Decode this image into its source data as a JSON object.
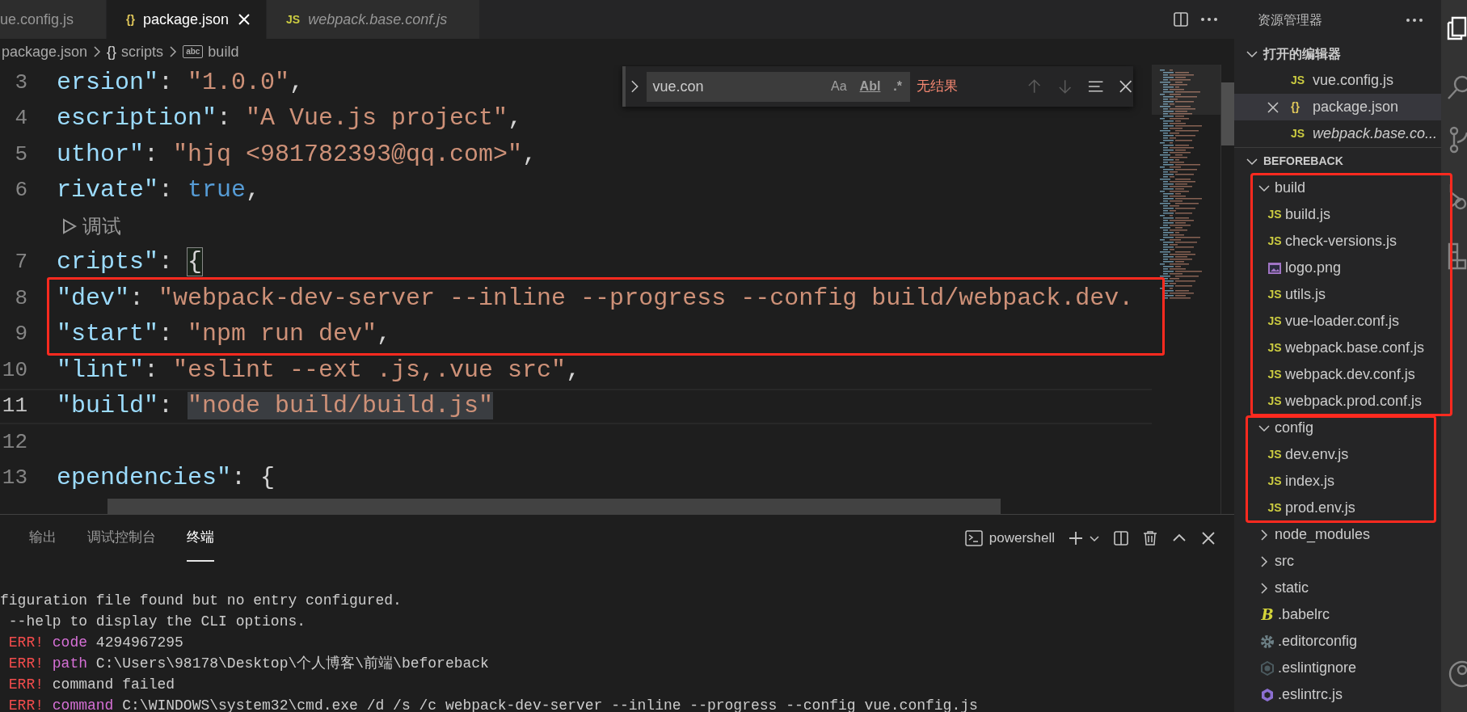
{
  "tabs": [
    {
      "label": "ue.config.js",
      "selected": false,
      "preview": false
    },
    {
      "label": "package.json",
      "kind": "json",
      "icon": "{}",
      "selected": true,
      "preview": false
    },
    {
      "label": "webpack.base.conf.js",
      "kind": "js",
      "icon": "JS",
      "selected": false,
      "preview": true
    }
  ],
  "breadcrumb": [
    {
      "text": "package.json"
    },
    {
      "kind": "object",
      "icon": "{}",
      "text": "scripts"
    },
    {
      "kind": "string",
      "icon": "abc",
      "text": "build"
    }
  ],
  "code": [
    {
      "kind": "code",
      "number": "3",
      "tokens": [
        {
          "kind": "key",
          "text": "ersion\""
        },
        {
          "kind": "punct",
          "text": ": "
        },
        {
          "kind": "string",
          "text": "\"1.0.0\""
        },
        {
          "kind": "punct",
          "text": ","
        }
      ]
    },
    {
      "kind": "code",
      "number": "4",
      "tokens": [
        {
          "kind": "key",
          "text": "escription\""
        },
        {
          "kind": "punct",
          "text": ": "
        },
        {
          "kind": "string",
          "text": "\"A Vue.js project\""
        },
        {
          "kind": "punct",
          "text": ","
        }
      ]
    },
    {
      "kind": "code",
      "number": "5",
      "tokens": [
        {
          "kind": "key",
          "text": "uthor\""
        },
        {
          "kind": "punct",
          "text": ": "
        },
        {
          "kind": "string",
          "text": "\"hjq <981782393@qq.com>\""
        },
        {
          "kind": "punct",
          "text": ","
        }
      ]
    },
    {
      "kind": "code",
      "number": "6",
      "tokens": [
        {
          "kind": "key",
          "text": "rivate\""
        },
        {
          "kind": "punct",
          "text": ": "
        },
        {
          "kind": "bool",
          "text": "true"
        },
        {
          "kind": "punct",
          "text": ","
        }
      ]
    },
    {
      "kind": "codelens",
      "text": "调试"
    },
    {
      "kind": "code",
      "number": "7",
      "tokens": [
        {
          "kind": "key",
          "text": "cripts\""
        },
        {
          "kind": "punct",
          "text": ": "
        },
        {
          "kind": "punct",
          "text": "{",
          "matched": true
        }
      ]
    },
    {
      "kind": "code",
      "number": "8",
      "highlighted": true,
      "tokens": [
        {
          "kind": "key",
          "text": "\"dev\""
        },
        {
          "kind": "punct",
          "text": ": "
        },
        {
          "kind": "string",
          "text": "\"webpack-dev-server --inline --progress --config build/webpack.dev."
        }
      ]
    },
    {
      "kind": "code",
      "number": "9",
      "highlighted": true,
      "tokens": [
        {
          "kind": "key",
          "text": "\"start\""
        },
        {
          "kind": "punct",
          "text": ": "
        },
        {
          "kind": "string",
          "text": "\"npm run dev\""
        },
        {
          "kind": "punct",
          "text": ","
        }
      ]
    },
    {
      "kind": "code",
      "number": "10",
      "tokens": [
        {
          "kind": "key",
          "text": "\"lint\""
        },
        {
          "kind": "punct",
          "text": ": "
        },
        {
          "kind": "string",
          "text": "\"eslint --ext .js,.vue src\""
        },
        {
          "kind": "punct",
          "text": ","
        }
      ]
    },
    {
      "kind": "code",
      "number": "11",
      "current": true,
      "tokens": [
        {
          "kind": "key",
          "text": "\"build\""
        },
        {
          "kind": "punct",
          "text": ": "
        },
        {
          "kind": "string",
          "text": "\"node build/build.js\"",
          "selected": true
        }
      ]
    },
    {
      "kind": "code",
      "number": "12"
    },
    {
      "kind": "code",
      "number": "13",
      "tokens": [
        {
          "kind": "key",
          "text": "ependencies\""
        },
        {
          "kind": "punct",
          "text": ": "
        },
        {
          "kind": "punct",
          "text": "{"
        }
      ]
    }
  ],
  "find": {
    "query": "vue.con",
    "options": [
      {
        "text": "Aa",
        "on": false
      },
      {
        "text": "Abl",
        "on": false
      },
      {
        "text": ".*",
        "on": false
      }
    ],
    "status": "无结果"
  },
  "panel": {
    "tabs": [
      {
        "label": "输出",
        "selected": false
      },
      {
        "label": "调试控制台",
        "selected": false
      },
      {
        "label": "终端",
        "selected": true
      }
    ],
    "shell": "powershell",
    "lines": [
      [
        {
          "kind": "text",
          "text": "figuration file found but no entry configured."
        }
      ],
      [
        {
          "kind": "text",
          "text": " --help to display the CLI options."
        }
      ],
      [
        {
          "kind": "err",
          "text": " ERR! "
        },
        {
          "kind": "keyword",
          "text": "code"
        },
        {
          "kind": "text",
          "text": " 4294967295"
        }
      ],
      [
        {
          "kind": "err",
          "text": " ERR! "
        },
        {
          "kind": "keyword",
          "text": "path"
        },
        {
          "kind": "text",
          "text": " C:\\Users\\98178\\Desktop\\个人博客\\前端\\beforeback"
        }
      ],
      [
        {
          "kind": "err",
          "text": " ERR! "
        },
        {
          "kind": "text",
          "text": "command failed"
        }
      ],
      [
        {
          "kind": "err",
          "text": " ERR! "
        },
        {
          "kind": "keyword",
          "text": "command"
        },
        {
          "kind": "text",
          "text": " C:\\WINDOWS\\system32\\cmd.exe /d /s /c webpack-dev-server --inline --progress --config vue.config.js"
        }
      ]
    ]
  },
  "sidebar": {
    "title": "资源管理器",
    "open_editors": {
      "title": "打开的编辑器",
      "expanded": true,
      "items": [
        {
          "name": "vue.config.js",
          "kind": "js",
          "icon": "JS",
          "selected": false,
          "preview": false
        },
        {
          "name": "package.json",
          "kind": "json",
          "icon": "{}",
          "selected": true,
          "preview": false
        },
        {
          "name": "webpack.base.co...",
          "kind": "js",
          "icon": "JS",
          "selected": false,
          "preview": true
        }
      ]
    },
    "project": {
      "title": "BEFOREBACK",
      "expanded": true,
      "items": [
        {
          "name": "build",
          "kind": "folder",
          "expanded": true,
          "highlighted": true,
          "children": [
            {
              "name": "build.js",
              "kind": "js",
              "icon": "JS"
            },
            {
              "name": "check-versions.js",
              "kind": "js",
              "icon": "JS"
            },
            {
              "name": "logo.png",
              "kind": "image"
            },
            {
              "name": "utils.js",
              "kind": "js",
              "icon": "JS"
            },
            {
              "name": "vue-loader.conf.js",
              "kind": "js",
              "icon": "JS"
            },
            {
              "name": "webpack.base.conf.js",
              "kind": "js",
              "icon": "JS"
            },
            {
              "name": "webpack.dev.conf.js",
              "kind": "js",
              "icon": "JS"
            },
            {
              "name": "webpack.prod.conf.js",
              "kind": "js",
              "icon": "JS"
            }
          ]
        },
        {
          "name": "config",
          "kind": "folder",
          "expanded": true,
          "highlighted": true,
          "children": [
            {
              "name": "dev.env.js",
              "kind": "js",
              "icon": "JS"
            },
            {
              "name": "index.js",
              "kind": "js",
              "icon": "JS"
            },
            {
              "name": "prod.env.js",
              "kind": "js",
              "icon": "JS"
            }
          ]
        },
        {
          "name": "node_modules",
          "kind": "folder",
          "expanded": false,
          "highlighted": false
        },
        {
          "name": "src",
          "kind": "folder",
          "expanded": false,
          "highlighted": false
        },
        {
          "name": "static",
          "kind": "folder",
          "expanded": false,
          "highlighted": false
        },
        {
          "name": ".babelrc",
          "kind": "babel",
          "icon": "B"
        },
        {
          "name": ".editorconfig",
          "kind": "gear"
        },
        {
          "name": ".eslintignore",
          "kind": "ignore"
        },
        {
          "name": ".eslintrc.js",
          "kind": "eslint"
        }
      ]
    }
  }
}
